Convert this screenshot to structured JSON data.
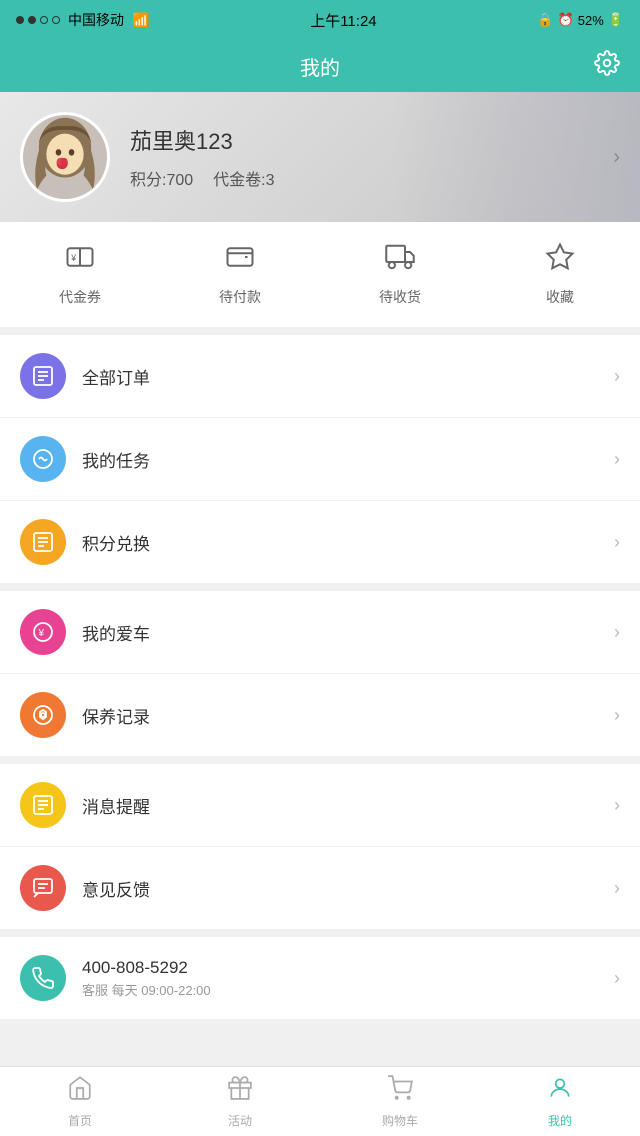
{
  "statusBar": {
    "carrier": "中国移动",
    "time": "上午11:24",
    "battery": "52%"
  },
  "header": {
    "title": "我的",
    "gearLabel": "⚙"
  },
  "profile": {
    "name": "茄里奥123",
    "points": "积分:700",
    "vouchers": "代金卷:3"
  },
  "quickActions": [
    {
      "id": "voucher",
      "label": "代金券",
      "icon": "voucher"
    },
    {
      "id": "pending-pay",
      "label": "待付款",
      "icon": "wallet"
    },
    {
      "id": "pending-receive",
      "label": "待收货",
      "icon": "truck"
    },
    {
      "id": "favorites",
      "label": "收藏",
      "icon": "star"
    }
  ],
  "menuGroups": [
    {
      "items": [
        {
          "id": "all-orders",
          "label": "全部订单",
          "colorClass": "ic-purple",
          "icon": "list"
        },
        {
          "id": "my-tasks",
          "label": "我的任务",
          "colorClass": "ic-blue",
          "icon": "task"
        },
        {
          "id": "points-exchange",
          "label": "积分兑换",
          "colorClass": "ic-orange",
          "icon": "exchange"
        }
      ]
    },
    {
      "items": [
        {
          "id": "my-car",
          "label": "我的爱车",
          "colorClass": "ic-pink",
          "icon": "car"
        },
        {
          "id": "maintenance",
          "label": "保养记录",
          "colorClass": "ic-orange2",
          "icon": "wrench"
        }
      ]
    },
    {
      "items": [
        {
          "id": "notifications",
          "label": "消息提醒",
          "colorClass": "ic-yellow",
          "icon": "bell"
        },
        {
          "id": "feedback",
          "label": "意见反馈",
          "colorClass": "ic-red",
          "icon": "feedback"
        }
      ]
    },
    {
      "items": [
        {
          "id": "hotline",
          "label": "400-808-5292",
          "sub": "客服 每天 09:00-22:00",
          "colorClass": "ic-teal",
          "icon": "phone"
        }
      ]
    }
  ],
  "bottomNav": [
    {
      "id": "home",
      "label": "首页",
      "icon": "home",
      "active": false
    },
    {
      "id": "activity",
      "label": "活动",
      "icon": "gift",
      "active": false
    },
    {
      "id": "cart",
      "label": "购物车",
      "icon": "cart",
      "active": false
    },
    {
      "id": "mine",
      "label": "我的",
      "icon": "user",
      "active": true
    }
  ]
}
